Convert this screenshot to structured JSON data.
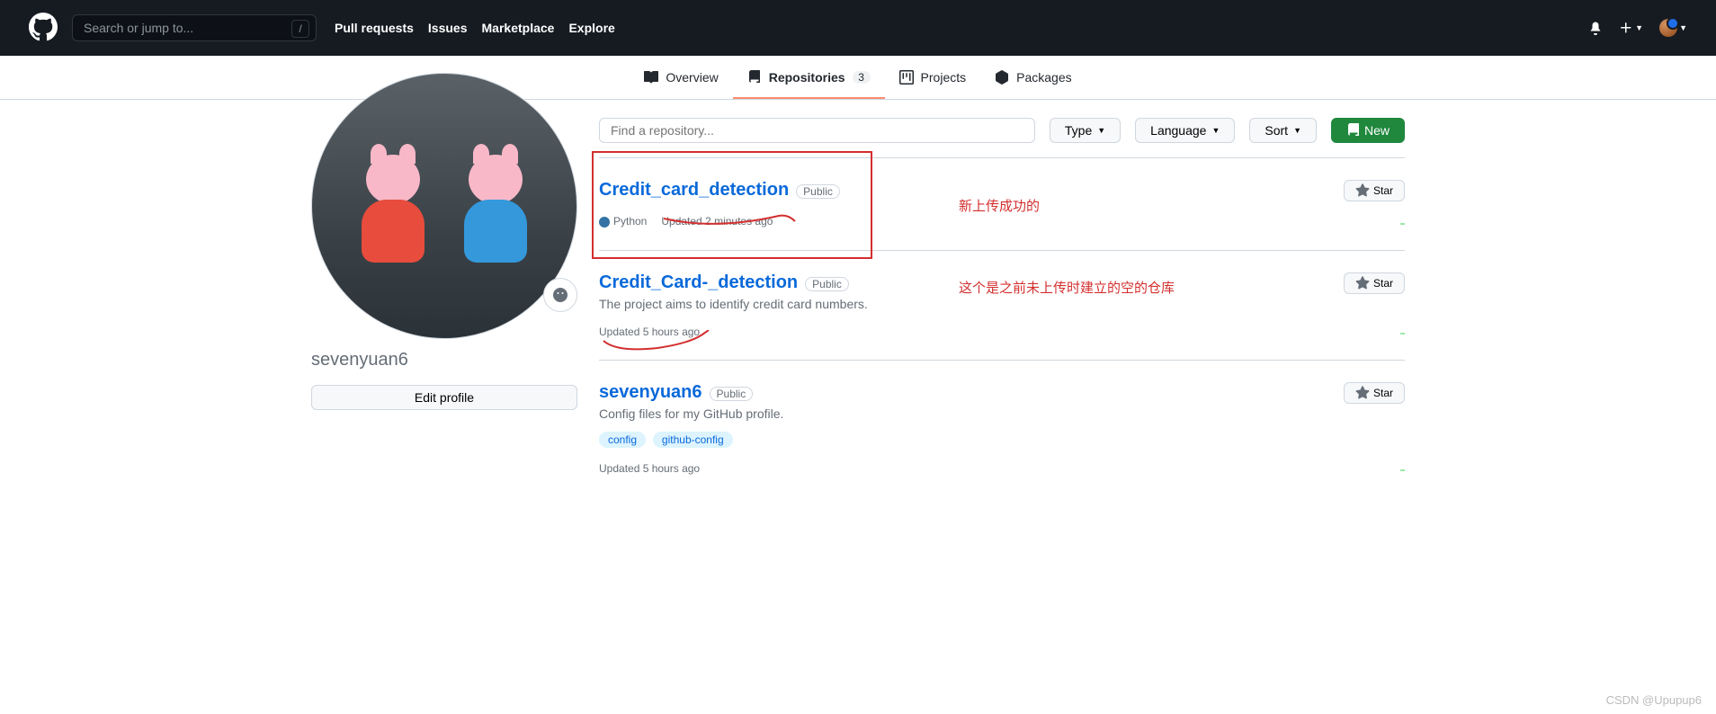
{
  "header": {
    "search_placeholder": "Search or jump to...",
    "slash": "/",
    "nav": {
      "pull_requests": "Pull requests",
      "issues": "Issues",
      "marketplace": "Marketplace",
      "explore": "Explore"
    }
  },
  "profile_nav": {
    "overview": "Overview",
    "repositories": "Repositories",
    "repositories_count": "3",
    "projects": "Projects",
    "packages": "Packages"
  },
  "sidebar": {
    "username": "sevenyuan6",
    "edit_profile": "Edit profile"
  },
  "filters": {
    "find_placeholder": "Find a repository...",
    "type": "Type",
    "language": "Language",
    "sort": "Sort",
    "new": "New"
  },
  "repos": [
    {
      "name": "Credit_card_detection",
      "visibility": "Public",
      "description": "",
      "language": "Python",
      "language_color": "#3572A5",
      "updated": "Updated 2 minutes ago",
      "star_label": "Star",
      "annotation": "新上传成功的",
      "topics": []
    },
    {
      "name": "Credit_Card-_detection",
      "visibility": "Public",
      "description": "The project aims to identify credit card numbers.",
      "language": "",
      "language_color": "",
      "updated": "Updated 5 hours ago",
      "star_label": "Star",
      "annotation": "这个是之前未上传时建立的空的仓库",
      "topics": []
    },
    {
      "name": "sevenyuan6",
      "visibility": "Public",
      "description": "Config files for my GitHub profile.",
      "language": "",
      "language_color": "",
      "updated": "Updated 5 hours ago",
      "star_label": "Star",
      "annotation": "",
      "topics": [
        "config",
        "github-config"
      ]
    }
  ],
  "watermark": "CSDN @Upupup6"
}
